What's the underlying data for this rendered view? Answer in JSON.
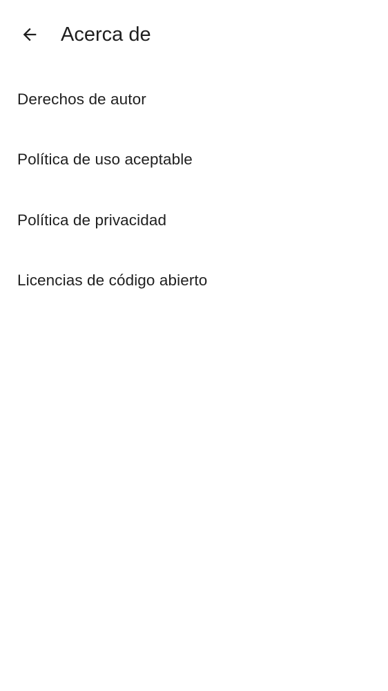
{
  "app_bar": {
    "back_icon": "arrow-back-icon",
    "title": "Acerca de"
  },
  "menu": {
    "items": [
      {
        "label": "Derechos de autor"
      },
      {
        "label": "Política de uso aceptable"
      },
      {
        "label": "Política de privacidad"
      },
      {
        "label": "Licencias de código abierto"
      }
    ]
  },
  "colors": {
    "background": "#ffffff",
    "text": "#1f1f1f"
  }
}
